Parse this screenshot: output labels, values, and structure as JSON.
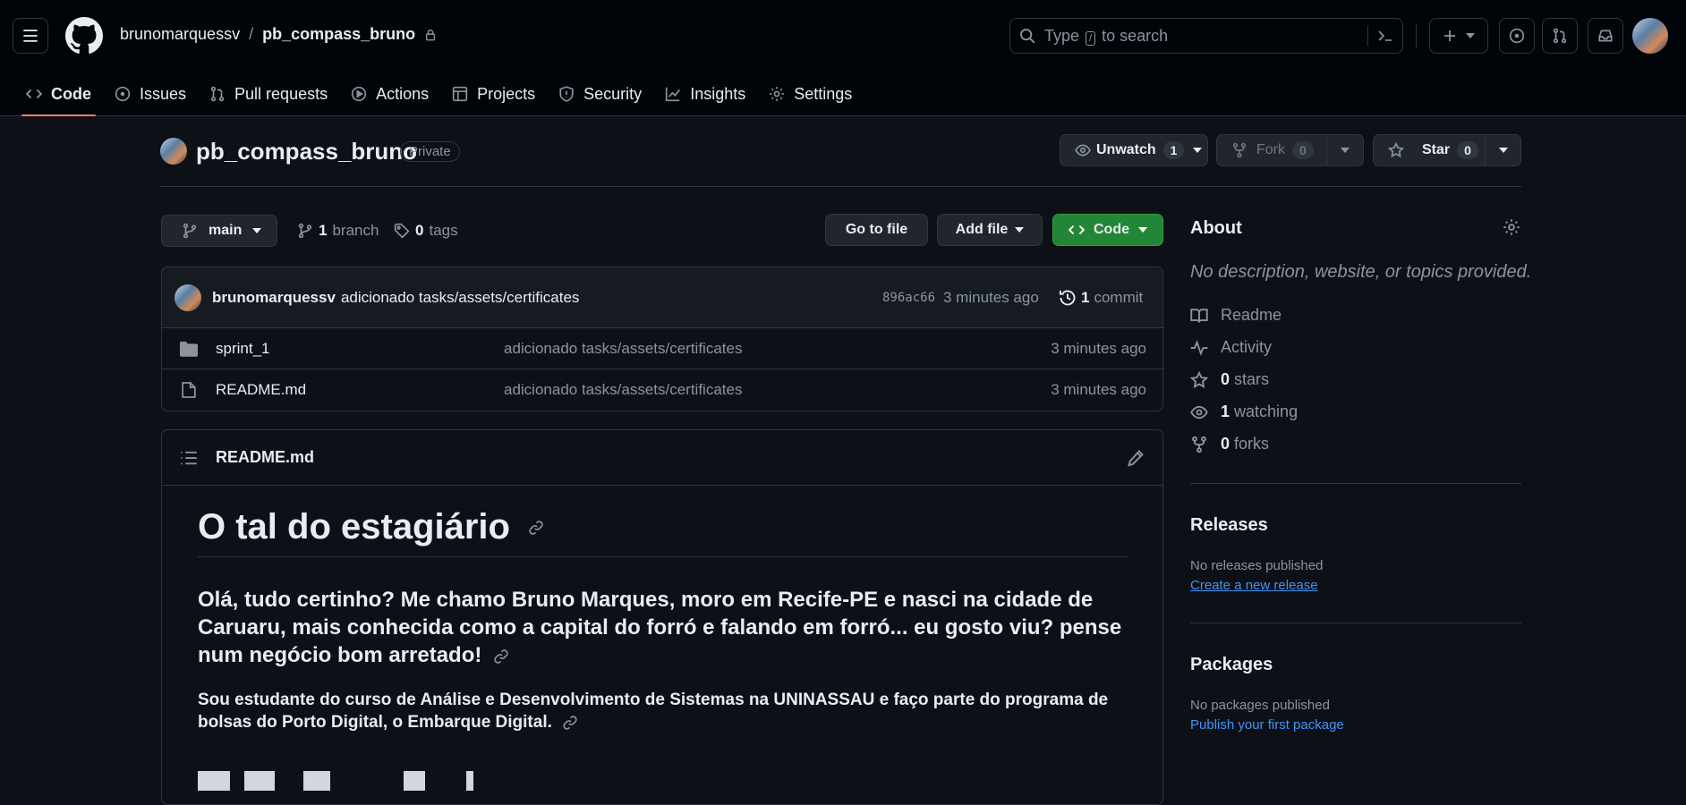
{
  "header": {
    "owner": "brunomarquessv",
    "separator": "/",
    "repo": "pb_compass_bruno",
    "search": {
      "prefix": "Type",
      "key": "/",
      "suffix": "to search"
    }
  },
  "tabs": [
    {
      "label": "Code",
      "icon": "code-icon"
    },
    {
      "label": "Issues",
      "icon": "issue-icon"
    },
    {
      "label": "Pull requests",
      "icon": "pull-request-icon"
    },
    {
      "label": "Actions",
      "icon": "play-icon"
    },
    {
      "label": "Projects",
      "icon": "table-icon"
    },
    {
      "label": "Security",
      "icon": "shield-icon"
    },
    {
      "label": "Insights",
      "icon": "graph-icon"
    },
    {
      "label": "Settings",
      "icon": "gear-icon"
    }
  ],
  "repo": {
    "title": "pb_compass_bruno",
    "visibility": "Private",
    "unwatch_label": "Unwatch",
    "watch_count": "1",
    "fork_label": "Fork",
    "fork_count": "0",
    "star_label": "Star",
    "star_count": "0"
  },
  "toolbar": {
    "branch": "main",
    "branch_count": "1",
    "branch_label": "branch",
    "tag_count": "0",
    "tag_label": "tags",
    "goto_file": "Go to file",
    "add_file": "Add file",
    "code": "Code"
  },
  "commit": {
    "author": "brunomarquessv",
    "message": "adicionado tasks/assets/certificates",
    "sha": "896ac66",
    "time": "3 minutes ago",
    "count": "1",
    "count_label": "commit"
  },
  "files": [
    {
      "name": "sprint_1",
      "type": "folder",
      "message": "adicionado tasks/assets/certificates",
      "time": "3 minutes ago"
    },
    {
      "name": "README.md",
      "type": "file",
      "message": "adicionado tasks/assets/certificates",
      "time": "3 minutes ago"
    }
  ],
  "readme": {
    "filename": "README.md",
    "h1": "O tal do estagiário",
    "h3": "Olá, tudo certinho? Me chamo Bruno Marques, moro em Recife-PE e nasci na cidade de Caruaru, mais conhecida como a capital do forró e falando em forró... eu gosto viu? pense num negócio bom arretado!",
    "p": "Sou estudante do curso de Análise e Desenvolvimento de Sistemas na UNINASSAU e faço parte do programa de bolsas do Porto Digital, o Embarque Digital."
  },
  "about": {
    "heading": "About",
    "description": "No description, website, or topics provided.",
    "readme": "Readme",
    "activity": "Activity",
    "stars_count": "0",
    "stars_label": "stars",
    "watching_count": "1",
    "watching_label": "watching",
    "forks_count": "0",
    "forks_label": "forks"
  },
  "releases": {
    "heading": "Releases",
    "empty": "No releases published",
    "link": "Create a new release"
  },
  "packages": {
    "heading": "Packages",
    "empty": "No packages published",
    "link": "Publish your first package"
  },
  "colors": {
    "accent_green": "#238636",
    "link_blue": "#4493f8",
    "tab_underline": "#f78166",
    "background": "#0d1117"
  }
}
